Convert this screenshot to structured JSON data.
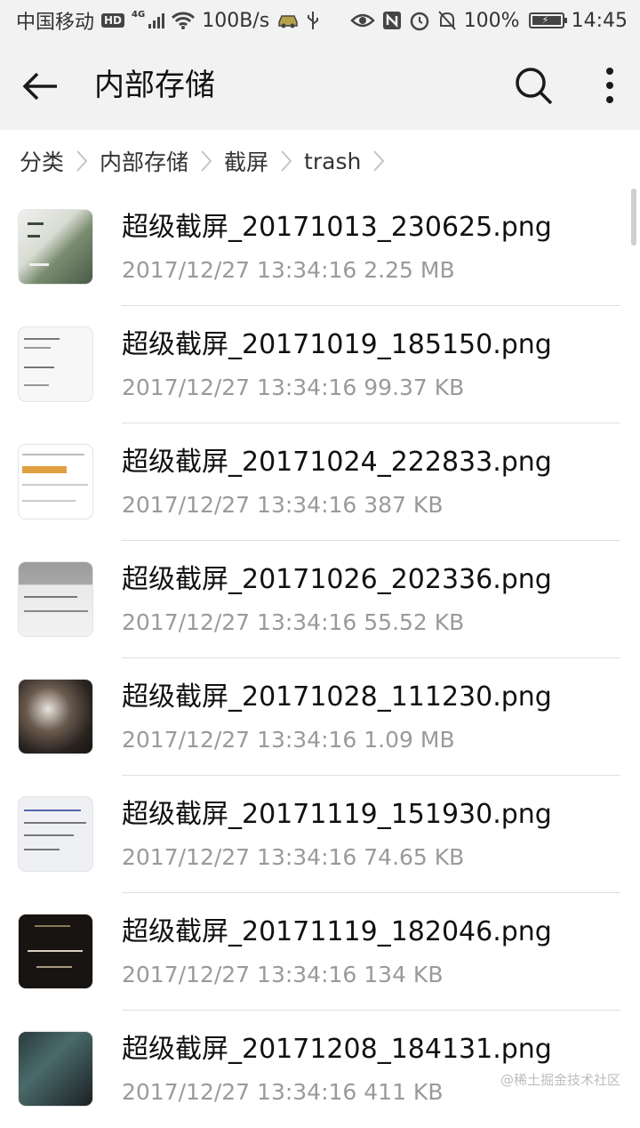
{
  "status_bar": {
    "carrier": "中国移动",
    "hd": "HD",
    "net_type": "4G",
    "speed": "100B/s",
    "battery": "100%",
    "time": "14:45",
    "icons": [
      "hd-icon",
      "signal-icon",
      "wifi-icon",
      "car-icon",
      "usb-icon",
      "eye-icon",
      "nfc-icon",
      "alarm-icon",
      "mute-icon",
      "battery-icon"
    ]
  },
  "toolbar": {
    "title": "内部存储",
    "back_icon": "back-arrow-icon",
    "search_icon": "search-icon",
    "more_icon": "more-vertical-icon"
  },
  "breadcrumb": [
    "分类",
    "内部存储",
    "截屏",
    "trash"
  ],
  "files": [
    {
      "name": "超级截屏_20171013_230625.png",
      "meta": "2017/12/27 13:34:16 2.25 MB"
    },
    {
      "name": "超级截屏_20171019_185150.png",
      "meta": "2017/12/27 13:34:16 99.37 KB"
    },
    {
      "name": "超级截屏_20171024_222833.png",
      "meta": "2017/12/27 13:34:16 387 KB"
    },
    {
      "name": "超级截屏_20171026_202336.png",
      "meta": "2017/12/27 13:34:16 55.52 KB"
    },
    {
      "name": "超级截屏_20171028_111230.png",
      "meta": "2017/12/27 13:34:16 1.09 MB"
    },
    {
      "name": "超级截屏_20171119_151930.png",
      "meta": "2017/12/27 13:34:16 74.65 KB"
    },
    {
      "name": "超级截屏_20171119_182046.png",
      "meta": "2017/12/27 13:34:16 134 KB"
    },
    {
      "name": "超级截屏_20171208_184131.png",
      "meta": "2017/12/27 13:34:16 411 KB"
    }
  ],
  "watermark": "@稀土掘金技术社区",
  "colors": {
    "toolbar_bg": "#f2f2f2",
    "primary_text": "#111111",
    "secondary_text": "#9a9a9a",
    "divider": "#dedede"
  }
}
